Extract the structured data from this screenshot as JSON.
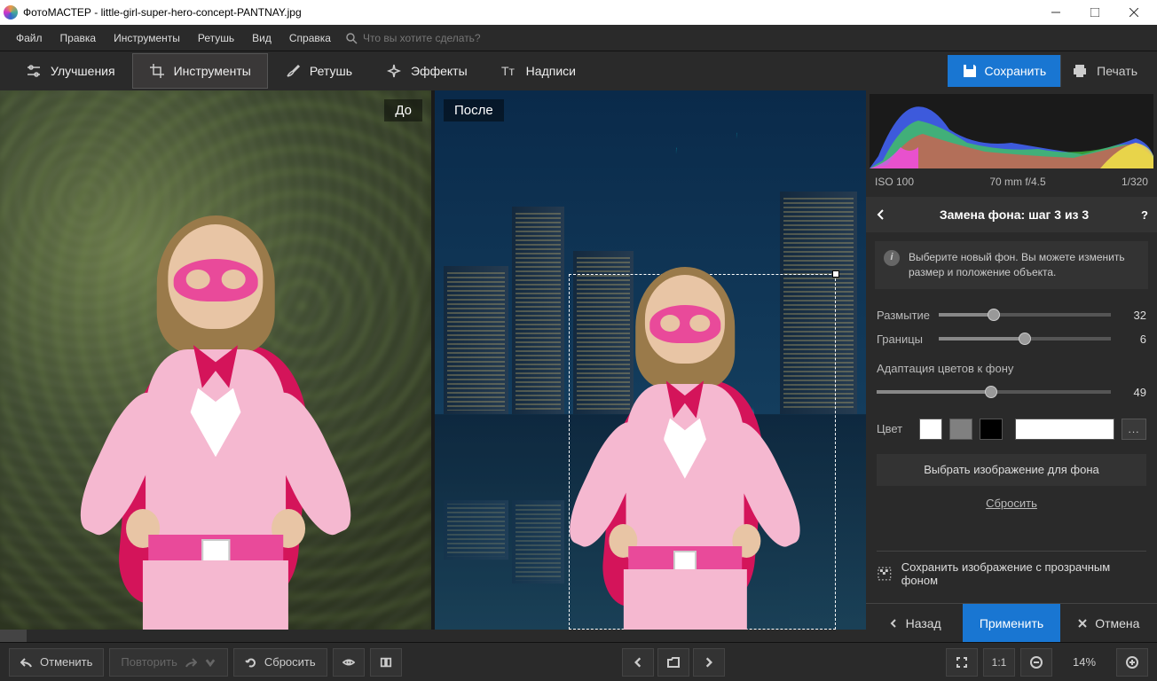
{
  "titlebar": {
    "title": "ФотоМАСТЕР - little-girl-super-hero-concept-PANTNAY.jpg"
  },
  "menubar": {
    "items": [
      "Файл",
      "Правка",
      "Инструменты",
      "Ретушь",
      "Вид",
      "Справка"
    ],
    "search_placeholder": "Что вы хотите сделать?"
  },
  "tabs": {
    "items": [
      "Улучшения",
      "Инструменты",
      "Ретушь",
      "Эффекты",
      "Надписи"
    ],
    "active_index": 1,
    "save_label": "Сохранить",
    "print_label": "Печать"
  },
  "canvas": {
    "before_label": "До",
    "after_label": "После"
  },
  "meta": {
    "iso": "ISO 100",
    "lens": "70 mm f/4.5",
    "shutter": "1/320"
  },
  "panel": {
    "title": "Замена фона: шаг 3 из 3",
    "info": "Выберите новый фон. Вы можете изменить размер и положение объекта.",
    "blur": {
      "label": "Размытие",
      "value": 32,
      "pct": 32
    },
    "edges": {
      "label": "Границы",
      "value": 6,
      "pct": 50
    },
    "adapt_heading": "Адаптация цветов к фону",
    "adapt": {
      "value": 49,
      "pct": 49
    },
    "color_label": "Цвет",
    "swatches": [
      "#ffffff",
      "#808080",
      "#000000"
    ],
    "dots_label": "...",
    "choose_bg": "Выбрать изображение для фона",
    "reset": "Сбросить",
    "save_transparent": "Сохранить изображение с прозрачным фоном",
    "back": "Назад",
    "apply": "Применить",
    "cancel": "Отмена"
  },
  "bottombar": {
    "undo": "Отменить",
    "redo": "Повторить",
    "reset": "Сбросить",
    "ratio": "1:1",
    "zoom": "14%"
  }
}
